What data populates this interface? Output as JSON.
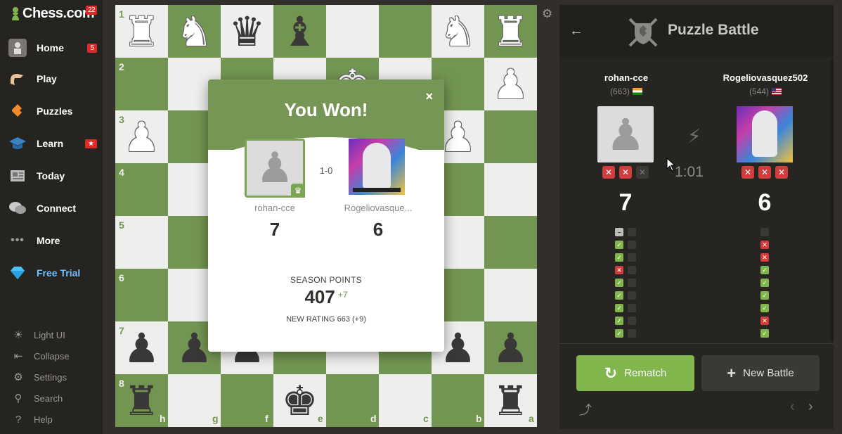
{
  "sidebar": {
    "logo_text": "Chess.com",
    "logo_badge": "22",
    "items": [
      {
        "label": "Home",
        "count": "5"
      },
      {
        "label": "Play"
      },
      {
        "label": "Puzzles"
      },
      {
        "label": "Learn",
        "count": "★"
      },
      {
        "label": "Today"
      },
      {
        "label": "Connect"
      },
      {
        "label": "More"
      },
      {
        "label": "Free Trial"
      }
    ],
    "bottom": [
      {
        "label": "Light UI",
        "icon": "sun-icon"
      },
      {
        "label": "Collapse",
        "icon": "collapse-icon"
      },
      {
        "label": "Settings",
        "icon": "gear-icon"
      },
      {
        "label": "Search",
        "icon": "search-icon"
      },
      {
        "label": "Help",
        "icon": "help-icon"
      }
    ]
  },
  "board": {
    "ranks": [
      "1",
      "2",
      "3",
      "4",
      "5",
      "6",
      "7",
      "8"
    ],
    "files": [
      "h",
      "g",
      "f",
      "e",
      "d",
      "c",
      "b",
      "a"
    ]
  },
  "modal": {
    "title": "You Won!",
    "close": "×",
    "result": "1-0",
    "player_left": {
      "name": "rohan-cce",
      "score": "7"
    },
    "player_right": {
      "name": "Rogeliovasque...",
      "score": "6"
    },
    "season_label": "SEASON POINTS",
    "season_points": "407",
    "season_delta": "+7",
    "new_rating": "NEW RATING 663 (+9)"
  },
  "panel": {
    "title": "Puzzle Battle",
    "player_left": {
      "name": "rohan-cce",
      "rating": "(663)",
      "score": "7"
    },
    "player_right": {
      "name": "Rogeliovasquez502",
      "rating": "(544)",
      "score": "6"
    },
    "timer": "1:01",
    "rematch_label": "Rematch",
    "new_battle_label": "New Battle",
    "history_left": [
      "neutral",
      "ok",
      "ok",
      "bad",
      "ok",
      "ok",
      "ok",
      "ok",
      "ok"
    ],
    "history_right": [
      "empty",
      "bad",
      "bad",
      "ok",
      "ok",
      "ok",
      "ok",
      "bad",
      "ok"
    ]
  },
  "colors": {
    "board_light": "#eeeeed",
    "board_dark": "#739552",
    "accent_green": "#81b64c",
    "error_red": "#d13c3c"
  }
}
